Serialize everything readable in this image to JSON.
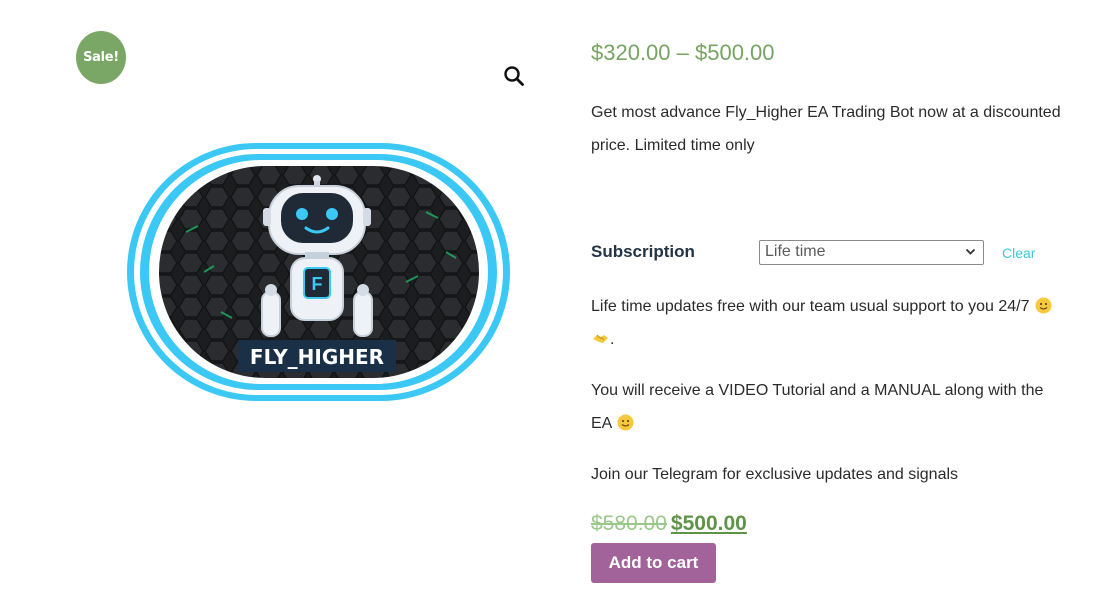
{
  "badge": {
    "sale": "Sale!"
  },
  "icons": {
    "zoom": "magnifier-icon",
    "select": "chevron-down-icon"
  },
  "product": {
    "logo_text": "FLY_HIGHER",
    "logo_badge_letter": "F",
    "price_range": "$320.00 – $500.00",
    "short_description": "Get most advance Fly_Higher EA Trading Bot now at a discounted price. Limited time only"
  },
  "variation": {
    "label": "Subscription",
    "selected": "Life time",
    "clear": "Clear",
    "desc1": "Life time updates free with our team usual support to you 24/7",
    "desc2": "You will receive a VIDEO Tutorial and a MANUAL along with the EA",
    "desc3": "Join our Telegram for exclusive updates and signals",
    "regular_price": "$580.00",
    "sale_price": "$500.00"
  },
  "actions": {
    "add_to_cart": "Add to cart"
  },
  "colors": {
    "sale_badge": "#7aa765",
    "price": "#77a464",
    "button": "#a2629a",
    "link": "#3fc6d8",
    "frame_blue": "#3cc8f4"
  }
}
